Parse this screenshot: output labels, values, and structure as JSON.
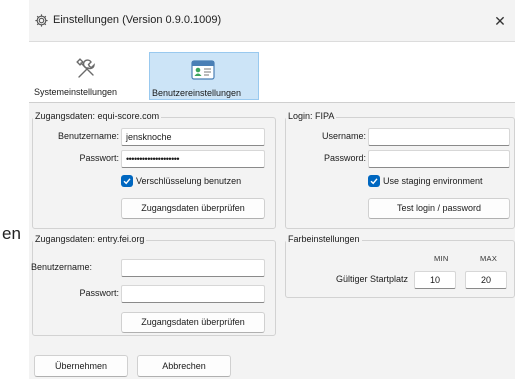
{
  "background_fragment": "en",
  "window": {
    "title": "Einstellungen (Version 0.9.0.1009)",
    "close_glyph": "✕"
  },
  "toolbar": {
    "items": [
      {
        "label": "Systemeinstellungen",
        "icon": "wrench-icon",
        "active": false
      },
      {
        "label": "Benutzereinstellungen",
        "icon": "user-card-icon",
        "active": true
      }
    ]
  },
  "equi": {
    "legend": "Zugangsdaten: equi-score.com",
    "username_label": "Benutzername:",
    "username_value": "jensknoche",
    "password_label": "Passwort:",
    "password_value": "••••••••••••••••••••",
    "encrypt_label": "Verschlüsselung benutzen",
    "encrypt_checked": true,
    "check_button": "Zugangsdaten überprüfen"
  },
  "fei": {
    "legend": "Zugangsdaten: entry.fei.org",
    "username_label": "Benutzername:",
    "username_value": "",
    "password_label": "Passwort:",
    "password_value": "",
    "check_button": "Zugangsdaten überprüfen"
  },
  "fipa": {
    "legend": "Login: FIPA",
    "username_label": "Username:",
    "username_value": "",
    "password_label": "Password:",
    "password_value": "",
    "staging_label": "Use staging environment",
    "staging_checked": true,
    "test_button": "Test login / password"
  },
  "colors_section": {
    "legend": "Farbeinstellungen",
    "min_header": "MIN",
    "max_header": "MAX",
    "row_label": "Gültiger Startplatz",
    "min_value": "10",
    "max_value": "20"
  },
  "footer": {
    "apply_button": "Übernehmen",
    "cancel_button": "Abbrechen"
  },
  "colors": {
    "accent": "#0067c0",
    "selected_tab_bg": "#cce4f7"
  }
}
